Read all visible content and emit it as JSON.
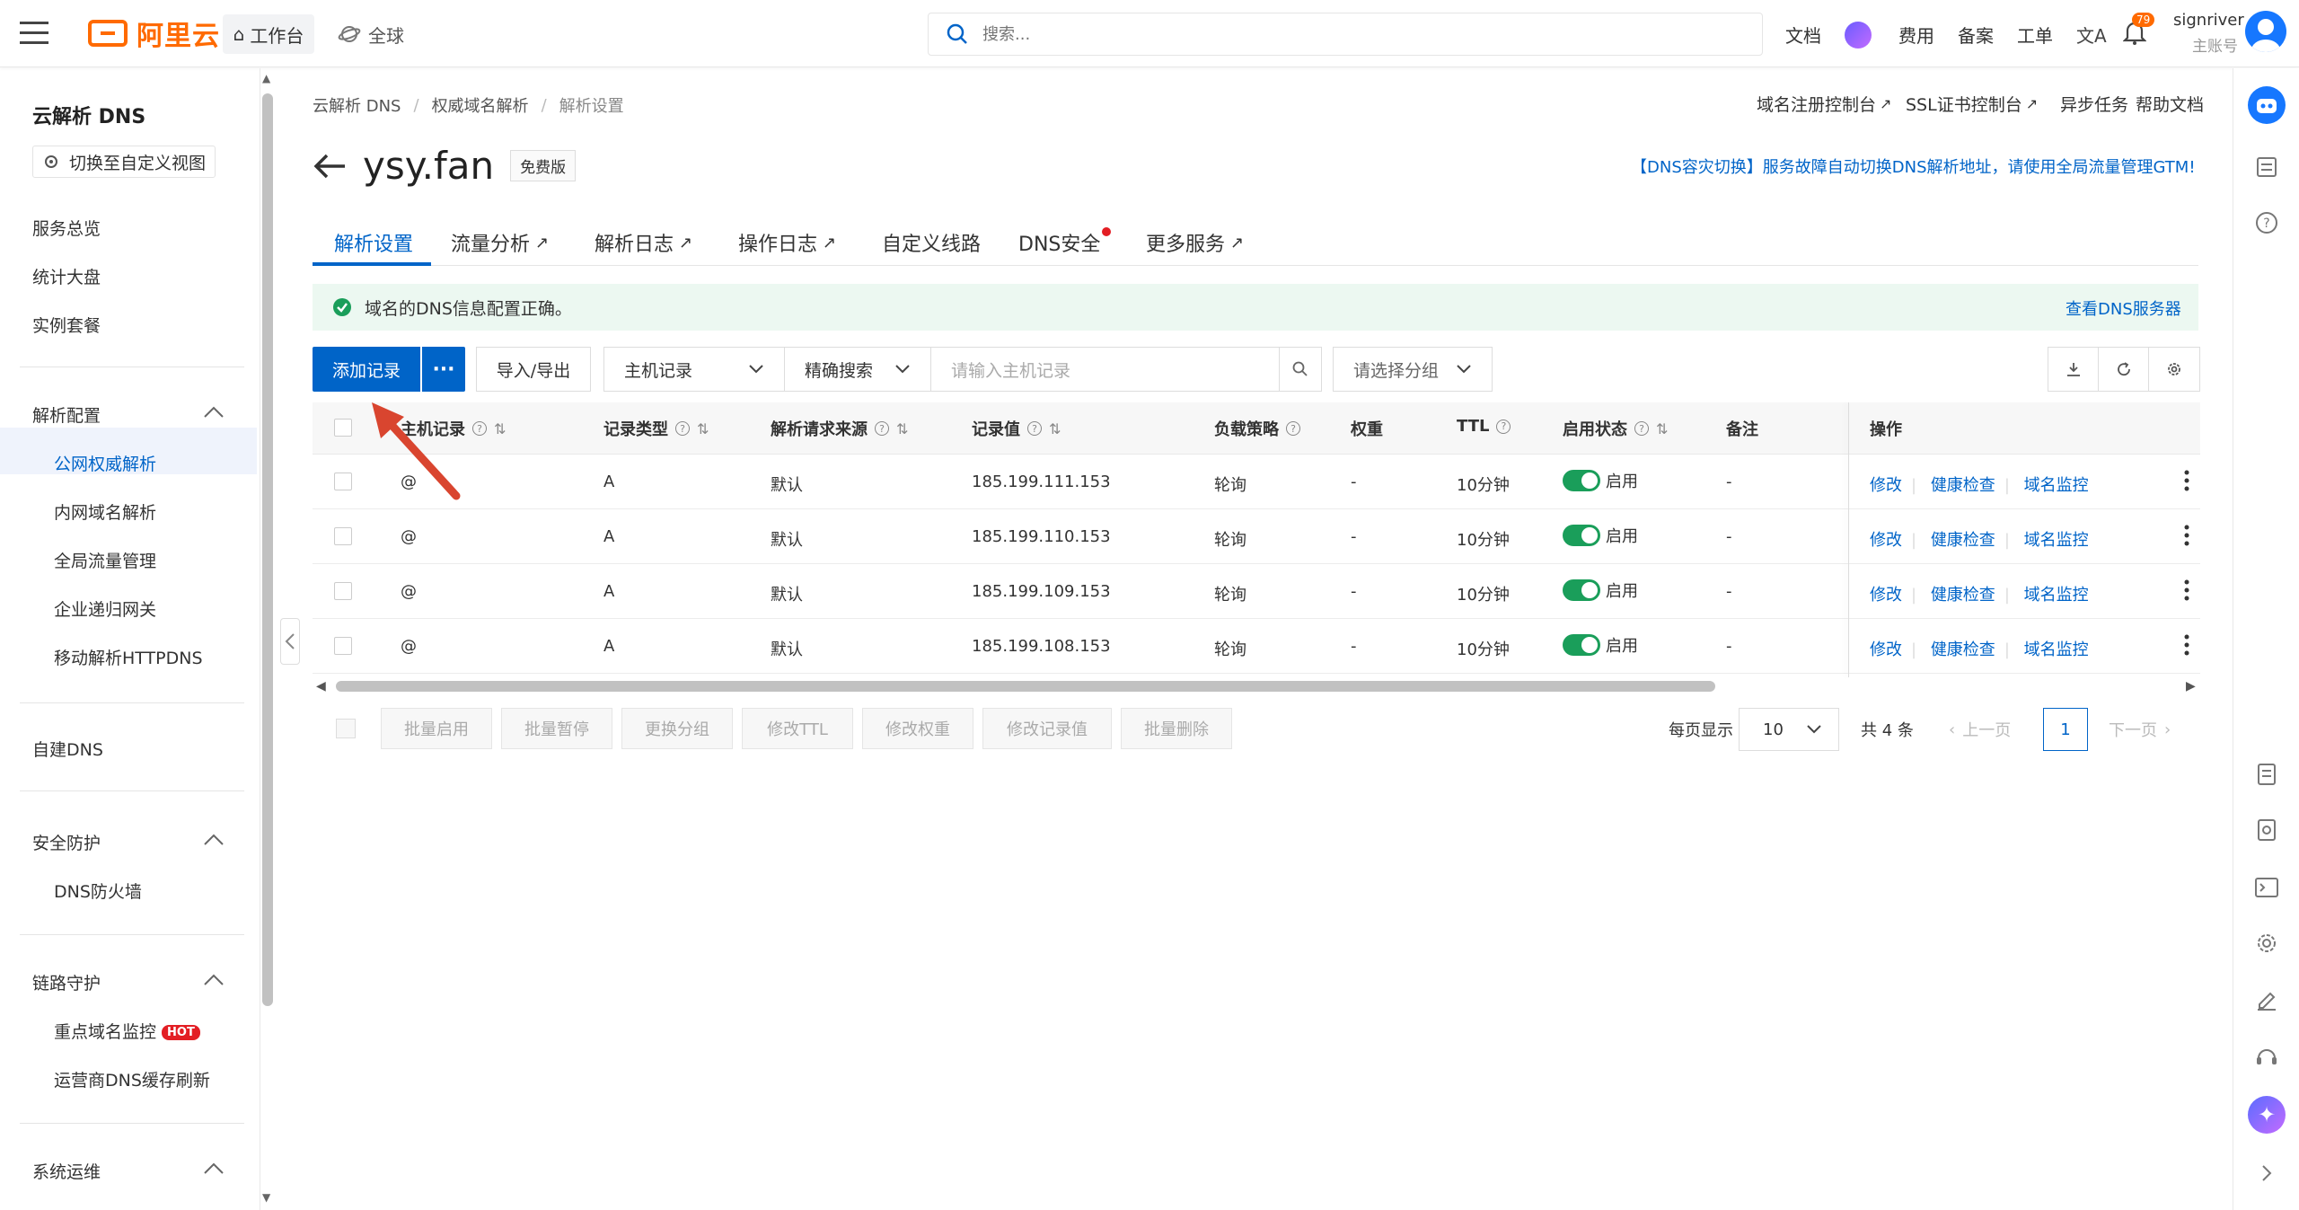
{
  "topbar": {
    "logo_text": "阿里云",
    "workbench": "工作台",
    "global": "全球",
    "search_placeholder": "搜索...",
    "links": [
      "文档",
      "费用",
      "备案",
      "工单"
    ],
    "notif_count": "79",
    "username": "signriver",
    "role": "主账号"
  },
  "sidebar": {
    "title": "云解析 DNS",
    "switch_view": "切换至自定义视图",
    "top_items": [
      "服务总览",
      "统计大盘",
      "实例套餐"
    ],
    "group1": {
      "label": "解析配置",
      "items": [
        "公网权威解析",
        "内网域名解析",
        "全局流量管理",
        "企业递归网关",
        "移动解析HTTPDNS"
      ],
      "active": "公网权威解析"
    },
    "self_dns": "自建DNS",
    "group2": {
      "label": "安全防护",
      "items": [
        "DNS防火墙"
      ]
    },
    "group3": {
      "label": "链路守护",
      "items": [
        "重点域名监控",
        "运营商DNS缓存刷新"
      ],
      "hot": "HOT"
    },
    "group4": {
      "label": "系统运维"
    }
  },
  "breadcrumb": [
    "云解析 DNS",
    "权威域名解析",
    "解析设置"
  ],
  "header_links": [
    "域名注册控制台",
    "SSL证书控制台",
    "异步任务",
    "帮助文档"
  ],
  "domain": "ysy.fan",
  "edition": "免费版",
  "gtm_banner": "【DNS容灾切换】服务故障自动切换DNS解析地址，请使用全局流量管理GTM!",
  "tabs": [
    "解析设置",
    "流量分析",
    "解析日志",
    "操作日志",
    "自定义线路",
    "DNS安全",
    "更多服务"
  ],
  "alert": {
    "text": "域名的DNS信息配置正确。",
    "link": "查看DNS服务器"
  },
  "toolbar": {
    "add": "添加记录",
    "more": "···",
    "import_export": "导入/导出",
    "host_record": "主机记录",
    "exact_search": "精确搜索",
    "search_placeholder": "请输入主机记录",
    "group_placeholder": "请选择分组"
  },
  "table": {
    "headers": [
      "主机记录",
      "记录类型",
      "解析请求来源",
      "记录值",
      "负载策略",
      "权重",
      "TTL",
      "启用状态",
      "备注",
      "操作"
    ],
    "rows": [
      {
        "host": "@",
        "type": "A",
        "source": "默认",
        "value": "185.199.111.153",
        "policy": "轮询",
        "weight": "-",
        "ttl": "10分钟",
        "status": "启用",
        "note": "-"
      },
      {
        "host": "@",
        "type": "A",
        "source": "默认",
        "value": "185.199.110.153",
        "policy": "轮询",
        "weight": "-",
        "ttl": "10分钟",
        "status": "启用",
        "note": "-"
      },
      {
        "host": "@",
        "type": "A",
        "source": "默认",
        "value": "185.199.109.153",
        "policy": "轮询",
        "weight": "-",
        "ttl": "10分钟",
        "status": "启用",
        "note": "-"
      },
      {
        "host": "@",
        "type": "A",
        "source": "默认",
        "value": "185.199.108.153",
        "policy": "轮询",
        "weight": "-",
        "ttl": "10分钟",
        "status": "启用",
        "note": "-"
      }
    ],
    "ops": [
      "修改",
      "健康检查",
      "域名监控"
    ]
  },
  "bulk_actions": [
    "批量启用",
    "批量暂停",
    "更换分组",
    "修改TTL",
    "修改权重",
    "修改记录值",
    "批量删除"
  ],
  "pagination": {
    "per_page_label": "每页显示",
    "per_page": "10",
    "total": "共 4 条",
    "prev": "上一页",
    "current": "1",
    "next": "下一页"
  },
  "colors": {
    "primary": "#0064c8",
    "brand": "#ff6a00",
    "success": "#1a9e5a",
    "arrow": "#d9452f"
  }
}
